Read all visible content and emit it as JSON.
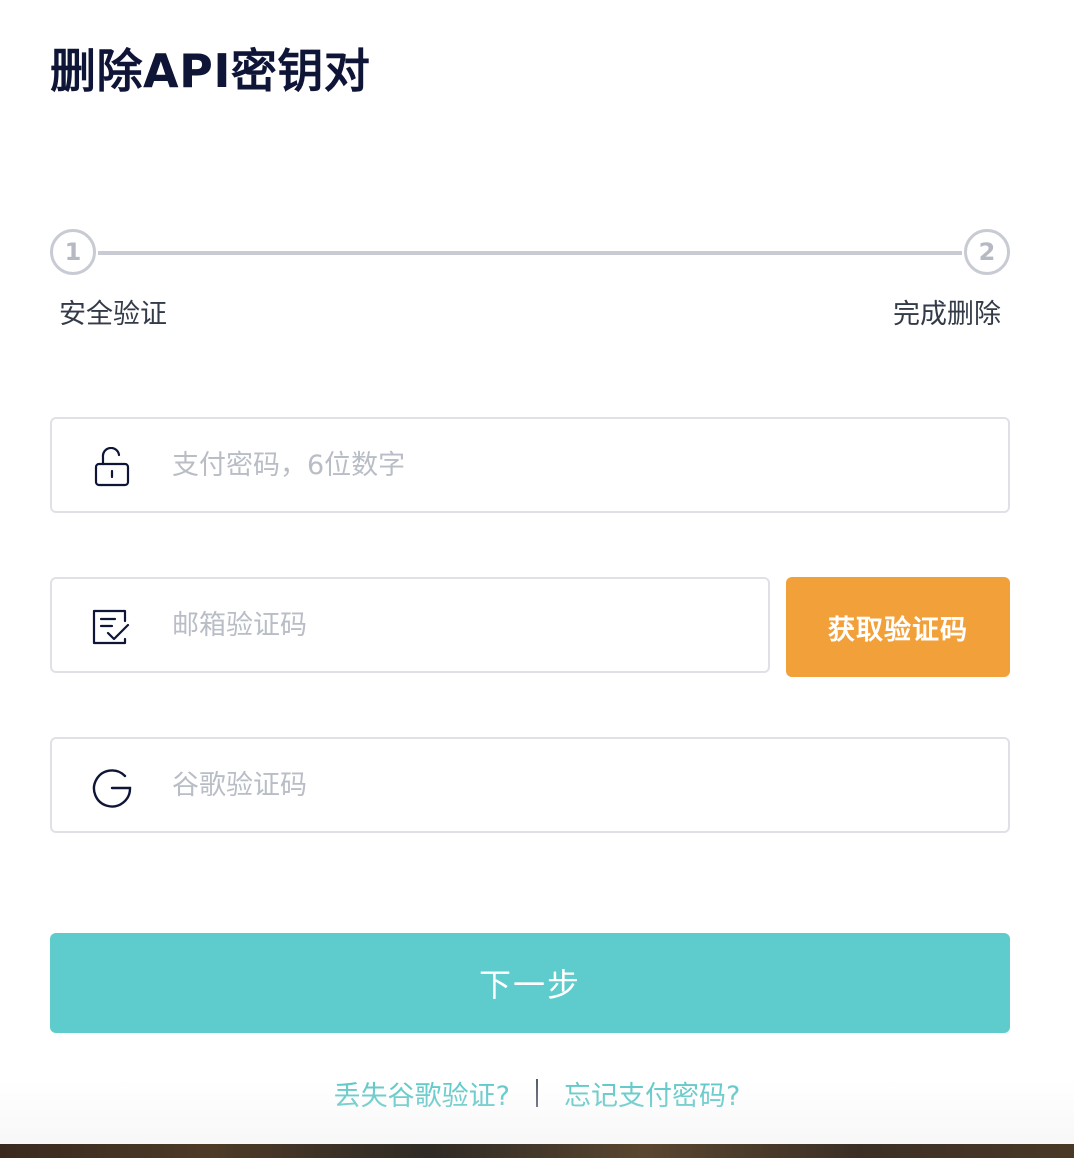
{
  "page": {
    "title": "删除API密钥对"
  },
  "stepper": {
    "steps": [
      {
        "number": "1",
        "label": "安全验证"
      },
      {
        "number": "2",
        "label": "完成删除"
      }
    ]
  },
  "form": {
    "pay_password": {
      "placeholder": "支付密码，6位数字",
      "value": "",
      "icon": "unlock-icon"
    },
    "email_code": {
      "placeholder": "邮箱验证码",
      "value": "",
      "icon": "email-verify-icon"
    },
    "google_code": {
      "placeholder": "谷歌验证码",
      "value": "",
      "icon": "google-icon"
    },
    "get_code_label": "获取验证码",
    "next_label": "下一步"
  },
  "links": {
    "lost_google": "丢失谷歌验证?",
    "forgot_pay": "忘记支付密码?"
  },
  "colors": {
    "title": "#0e1537",
    "accent_orange": "#f2a03a",
    "accent_teal": "#5ecccc",
    "link_teal": "#5ec8c8",
    "step_gray": "#c8cbd3"
  }
}
